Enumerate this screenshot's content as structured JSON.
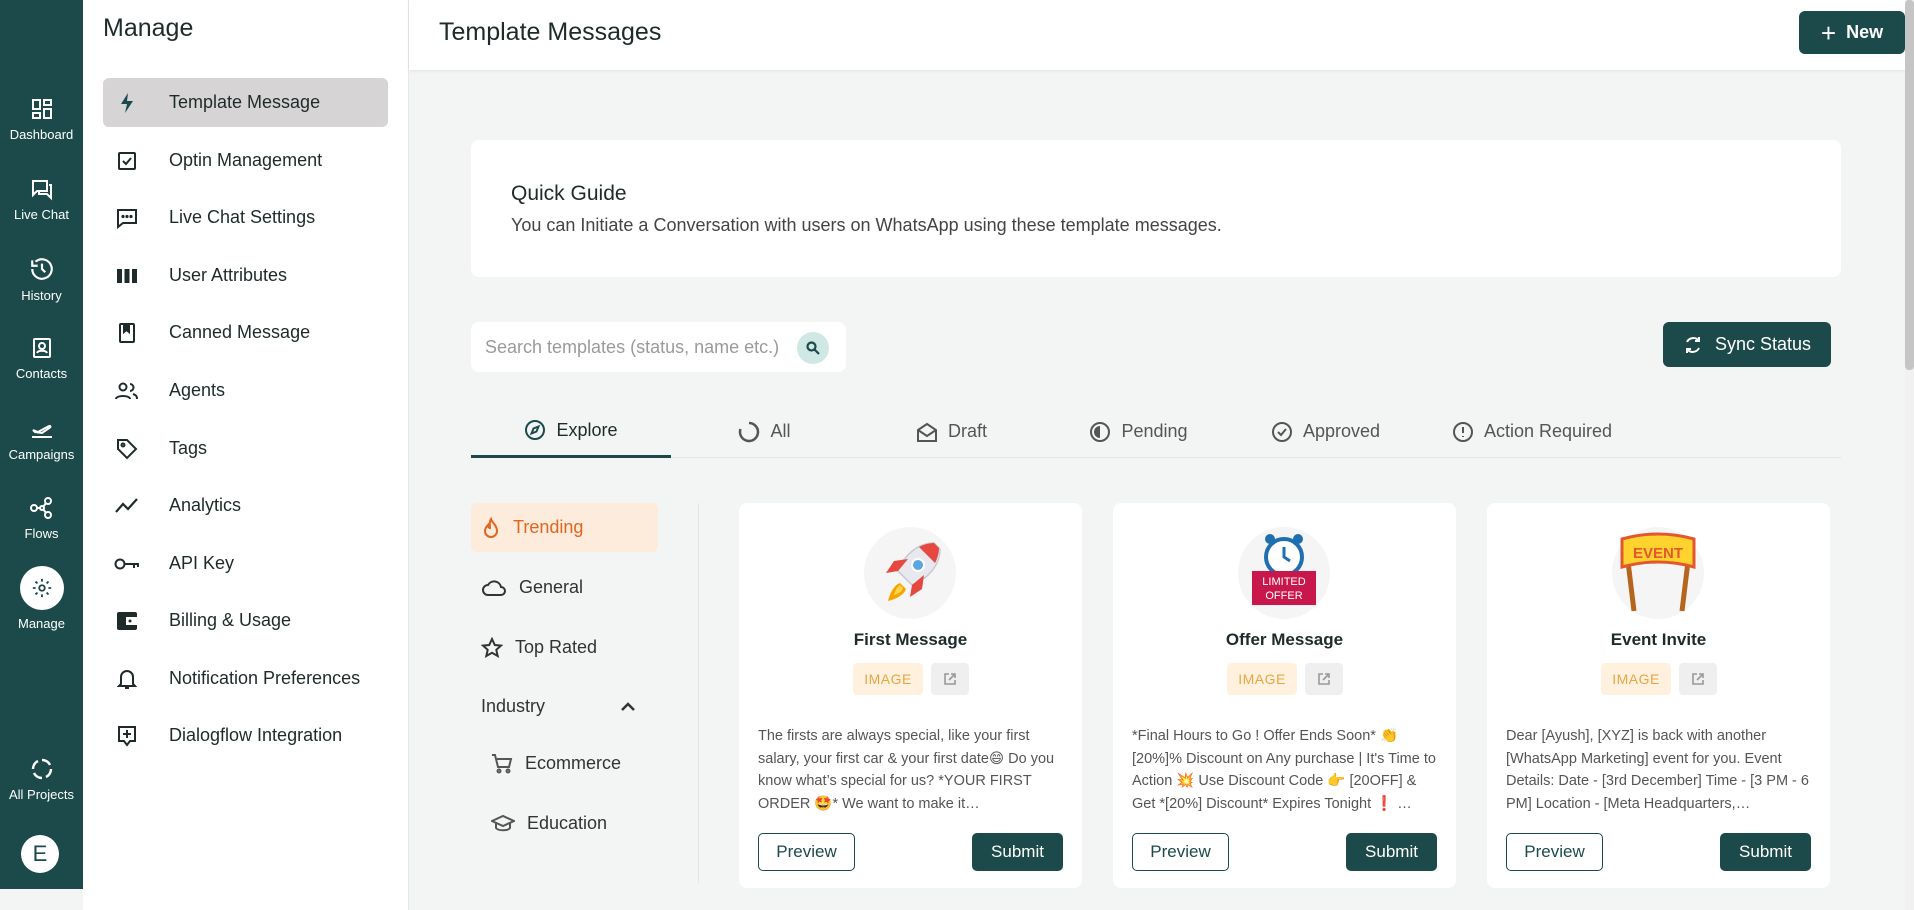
{
  "rail": {
    "items": [
      {
        "label": "Dashboard",
        "icon": "dashboard-icon"
      },
      {
        "label": "Live Chat",
        "icon": "chat-icon"
      },
      {
        "label": "History",
        "icon": "history-icon"
      },
      {
        "label": "Contacts",
        "icon": "contacts-icon"
      },
      {
        "label": "Campaigns",
        "icon": "campaigns-icon"
      },
      {
        "label": "Flows",
        "icon": "flows-icon"
      },
      {
        "label": "Manage",
        "icon": "gear-icon"
      }
    ],
    "all_projects": "All Projects",
    "avatar_letter": "E"
  },
  "manage": {
    "title": "Manage",
    "items": [
      {
        "label": "Template Message",
        "icon": "bolt-icon"
      },
      {
        "label": "Optin Management",
        "icon": "checkbox-icon"
      },
      {
        "label": "Live Chat Settings",
        "icon": "chat-bubble-icon"
      },
      {
        "label": "User Attributes",
        "icon": "columns-icon"
      },
      {
        "label": "Canned Message",
        "icon": "book-icon"
      },
      {
        "label": "Agents",
        "icon": "people-icon"
      },
      {
        "label": "Tags",
        "icon": "tag-icon"
      },
      {
        "label": "Analytics",
        "icon": "trend-icon"
      },
      {
        "label": "API Key",
        "icon": "key-icon"
      },
      {
        "label": "Billing & Usage",
        "icon": "wallet-icon"
      },
      {
        "label": "Notification Preferences",
        "icon": "bell-icon"
      },
      {
        "label": "Dialogflow Integration",
        "icon": "dialogflow-icon"
      }
    ]
  },
  "header": {
    "title": "Template Messages",
    "new_label": "New"
  },
  "guide": {
    "title": "Quick Guide",
    "text": "You can Initiate a Conversation with users on WhatsApp using these template messages."
  },
  "search": {
    "placeholder": "Search templates (status, name etc.)"
  },
  "sync_label": "Sync Status",
  "tabs": [
    {
      "label": "Explore",
      "icon": "compass-icon"
    },
    {
      "label": "All",
      "icon": "spinner-icon"
    },
    {
      "label": "Draft",
      "icon": "envelope-open-icon"
    },
    {
      "label": "Pending",
      "icon": "half-circle-icon"
    },
    {
      "label": "Approved",
      "icon": "check-circle-icon"
    },
    {
      "label": "Action Required",
      "icon": "alert-circle-icon"
    }
  ],
  "categories": {
    "trending": "Trending",
    "general": "General",
    "top_rated": "Top Rated",
    "industry": "Industry",
    "ecommerce": "Ecommerce",
    "education": "Education"
  },
  "cards": [
    {
      "title": "First Message",
      "badge": "IMAGE",
      "body": "The firsts are always special, like your first salary, your first car & your first date😄 Do you know what’s special for us? *YOUR FIRST ORDER 🤩* We want to make it…",
      "preview": "Preview",
      "submit": "Submit",
      "illustration": "rocket-icon"
    },
    {
      "title": "Offer Message",
      "badge": "IMAGE",
      "body": "*Final Hours to Go ! Offer Ends Soon* 👏 [20%]% Discount on Any purchase | It's Time to Action 💥 Use Discount Code 👉 [20OFF] & Get *[20%] Discount* Expires Tonight ❗ …",
      "preview": "Preview",
      "submit": "Submit",
      "illustration": "limited-offer-icon",
      "illustration_text": [
        "LIMITED",
        "OFFER"
      ]
    },
    {
      "title": "Event Invite",
      "badge": "IMAGE",
      "body": "Dear [Ayush], [XYZ] is back with another [WhatsApp Marketing] event for you. Event Details: Date - [3rd December] Time - [3 PM - 6 PM] Location - [Meta Headquarters,…",
      "preview": "Preview",
      "submit": "Submit",
      "illustration": "event-banner-icon",
      "illustration_text": "EVENT"
    }
  ],
  "colors": {
    "brand": "#1c4a4a",
    "accent_orange": "#e0661f",
    "badge_bg": "#fff1dd",
    "badge_text": "#e7a646"
  }
}
